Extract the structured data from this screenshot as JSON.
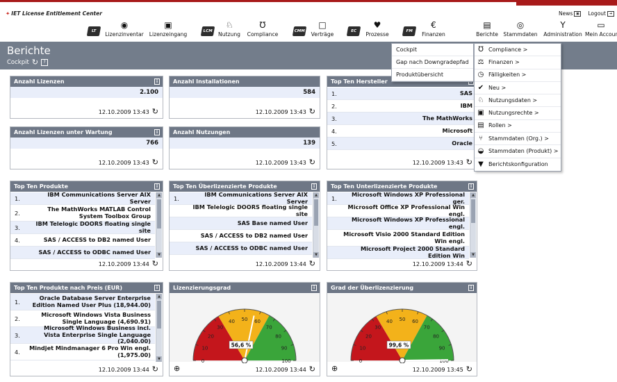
{
  "header": {
    "logo_text": "IET License Entitlement Center",
    "top_links": [
      {
        "label": "News",
        "icon": "news-icon"
      },
      {
        "label": "Logout",
        "icon": "logout-icon"
      }
    ],
    "nav": [
      {
        "label": "",
        "badge": "LT"
      },
      {
        "label": "Lizenzinventar",
        "icon": "◉"
      },
      {
        "label": "Lizenzeingang",
        "icon": "▣"
      },
      {
        "label": "",
        "badge": "LCM"
      },
      {
        "label": "Nutzung",
        "icon": "♘"
      },
      {
        "label": "Compliance",
        "icon": "℧"
      },
      {
        "label": "",
        "badge": "CMM"
      },
      {
        "label": "Verträge",
        "icon": "□"
      },
      {
        "label": "",
        "badge": "EC"
      },
      {
        "label": "Prozesse",
        "icon": "♥"
      },
      {
        "label": "",
        "badge": "FM"
      },
      {
        "label": "Finanzen",
        "icon": "€"
      },
      {
        "label": "Berichte",
        "icon": "▤"
      },
      {
        "label": "Stammdaten",
        "icon": "◎"
      },
      {
        "label": "Administration",
        "icon": "Y"
      },
      {
        "label": "Mein Accoun",
        "icon": "▭"
      }
    ]
  },
  "page": {
    "title": "Berichte",
    "breadcrumb": "Cockpit",
    "help": "?"
  },
  "menu_berichte": [
    "Cockpit",
    "Gap nach Downgradepfad",
    "Produktübersicht"
  ],
  "menu_main": [
    {
      "label": "Compliance >",
      "icon": "℧"
    },
    {
      "label": "Finanzen >",
      "icon": "⚖"
    },
    {
      "label": "Fälligkeiten >",
      "icon": "◷"
    },
    {
      "label": "Neu >",
      "icon": "✔"
    },
    {
      "label": "Nutzungsdaten >",
      "icon": "♘"
    },
    {
      "label": "Nutzungsrechte >",
      "icon": "▣"
    },
    {
      "label": "Rollen >",
      "icon": "▤"
    },
    {
      "label": "Stammdaten (Org.) >",
      "icon": "⑂"
    },
    {
      "label": "Stammdaten (Produkt) >",
      "icon": "◒"
    },
    {
      "label": "Berichtskonfiguration",
      "icon": "▼"
    }
  ],
  "widgets": {
    "anzahl_lizenzen": {
      "title": "Anzahl Lizenzen",
      "value": "2.100",
      "date": "12.10.2009 13:43"
    },
    "anzahl_installationen": {
      "title": "Anzahl Installationen",
      "value": "584",
      "date": "12.10.2009 13:43"
    },
    "top_hersteller": {
      "title": "Top Ten Hersteller",
      "rows": [
        {
          "n": "1.",
          "t": "SAS"
        },
        {
          "n": "2.",
          "t": "IBM"
        },
        {
          "n": "3.",
          "t": "The MathWorks"
        },
        {
          "n": "4.",
          "t": "Microsoft"
        },
        {
          "n": "5.",
          "t": "Oracle"
        }
      ],
      "date": "12.10.2009 13:43"
    },
    "lizenzen_wartung": {
      "title": "Anzahl Lizenzen unter Wartung",
      "value": "766",
      "date": "12.10.2009 13:43"
    },
    "anzahl_nutzungen": {
      "title": "Anzahl Nutzungen",
      "value": "139",
      "date": "12.10.2009 13:43"
    },
    "top_produkte": {
      "title": "Top Ten Produkte",
      "rows": [
        {
          "n": "1.",
          "t": "IBM Communications Server AIX Server"
        },
        {
          "n": "2.",
          "t": "The MathWorks MATLAB Control System Toolbox Group"
        },
        {
          "n": "3.",
          "t": "IBM Telelogic DOORS floating single site"
        },
        {
          "n": "4.",
          "t": "SAS / ACCESS to DB2 named User"
        },
        {
          "n": "",
          "t": "SAS / ACCESS to ODBC named User"
        }
      ],
      "date": "12.10.2009 13:44"
    },
    "top_ueberlizenziert": {
      "title": "Top Ten Überlizenzierte Produkte",
      "rows": [
        {
          "n": "1.",
          "t": "IBM Communications Server AIX Server"
        },
        {
          "n": "",
          "t": "IBM Telelogic DOORS floating single site"
        },
        {
          "n": "",
          "t": "SAS Base named User"
        },
        {
          "n": "",
          "t": "SAS / ACCESS to DB2 named User"
        },
        {
          "n": "",
          "t": "SAS / ACCESS to ODBC named User"
        }
      ],
      "date": "12.10.2009 13:44"
    },
    "top_unterlizenziert": {
      "title": "Top Ten Unterlizenzierte Produkte",
      "rows": [
        {
          "n": "1.",
          "t": "Microsoft Windows XP Professional ger."
        },
        {
          "n": "",
          "t": "Microsoft Office XP Professional Win engl."
        },
        {
          "n": "",
          "t": "Microsoft Windows XP Professional engl."
        },
        {
          "n": "",
          "t": "Microsoft Visio 2000 Standard Edition Win engl."
        },
        {
          "n": "",
          "t": "Microsoft Project 2000 Standard Edition Win"
        }
      ],
      "date": "12.10.2009 13:44"
    },
    "top_preis": {
      "title": "Top Ten Produkte nach Preis (EUR)",
      "rows": [
        {
          "n": "1.",
          "t": "Oracle Database Server Enterprise Edition Named User Plus (18,944.00)"
        },
        {
          "n": "2.",
          "t": "Microsoft Windows Vista Business Single Language (4,690.91)"
        },
        {
          "n": "3.",
          "t": "Microsoft Windows Business incl. Vista Enterprise Single Language (2,040.00)"
        },
        {
          "n": "4.",
          "t": "Mindjet Mindmanager 6 Pro Win engl. (1,975.00)"
        }
      ],
      "date": "12.10.2009 13:44"
    },
    "lizenzierungsgrad": {
      "title": "Lizenzierungsgrad",
      "value": 56.6,
      "label": "56,6 %",
      "date": "12.10.2009 13:44"
    },
    "ueberlizenzierung": {
      "title": "Grad der Überlizenzierung",
      "value": 99.6,
      "label": "99,6 %",
      "date": "12.10.2009 13:45"
    }
  },
  "gauge_ticks": [
    "0",
    "10",
    "20",
    "30",
    "40",
    "50",
    "60",
    "70",
    "80",
    "90",
    "100"
  ],
  "colors": {
    "red": "#c4161c",
    "yellow": "#f3b21a",
    "green": "#3aa53a",
    "header": "#6e7786",
    "band": "#737d8b"
  }
}
